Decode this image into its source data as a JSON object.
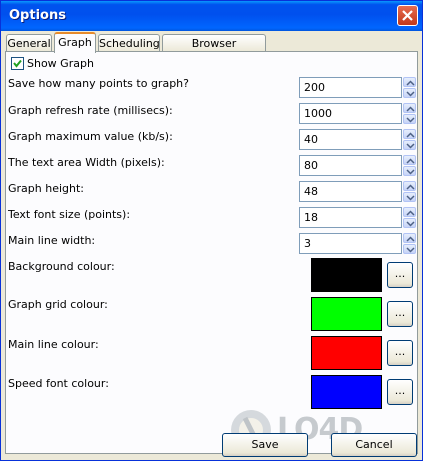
{
  "window": {
    "title": "Options"
  },
  "tabs": [
    {
      "label": "General",
      "active": false
    },
    {
      "label": "Graph",
      "active": true
    },
    {
      "label": "Scheduling",
      "active": false
    },
    {
      "label": "Browser Integration",
      "active": false
    }
  ],
  "show_graph": {
    "label": "Show Graph",
    "checked": true
  },
  "fields": [
    {
      "label": "Save how many points to graph?",
      "value": "200"
    },
    {
      "label": "Graph refresh rate (millisecs):",
      "value": "1000"
    },
    {
      "label": "Graph maximum value (kb/s):",
      "value": "40"
    },
    {
      "label": "The text area Width (pixels):",
      "value": "80"
    },
    {
      "label": "Graph height:",
      "value": "48"
    },
    {
      "label": "Text font size (points):",
      "value": "18"
    },
    {
      "label": "Main line width:",
      "value": "3"
    }
  ],
  "colours": [
    {
      "label": "Background colour:",
      "color": "#000000",
      "button": "..."
    },
    {
      "label": "Graph grid colour:",
      "color": "#00ff00",
      "button": "..."
    },
    {
      "label": "Main line colour:",
      "color": "#ff0000",
      "button": "..."
    },
    {
      "label": "Speed font colour:",
      "color": "#0000ff",
      "button": "..."
    }
  ],
  "buttons": {
    "save": "Save",
    "cancel": "Cancel"
  },
  "watermark": "LO4D"
}
